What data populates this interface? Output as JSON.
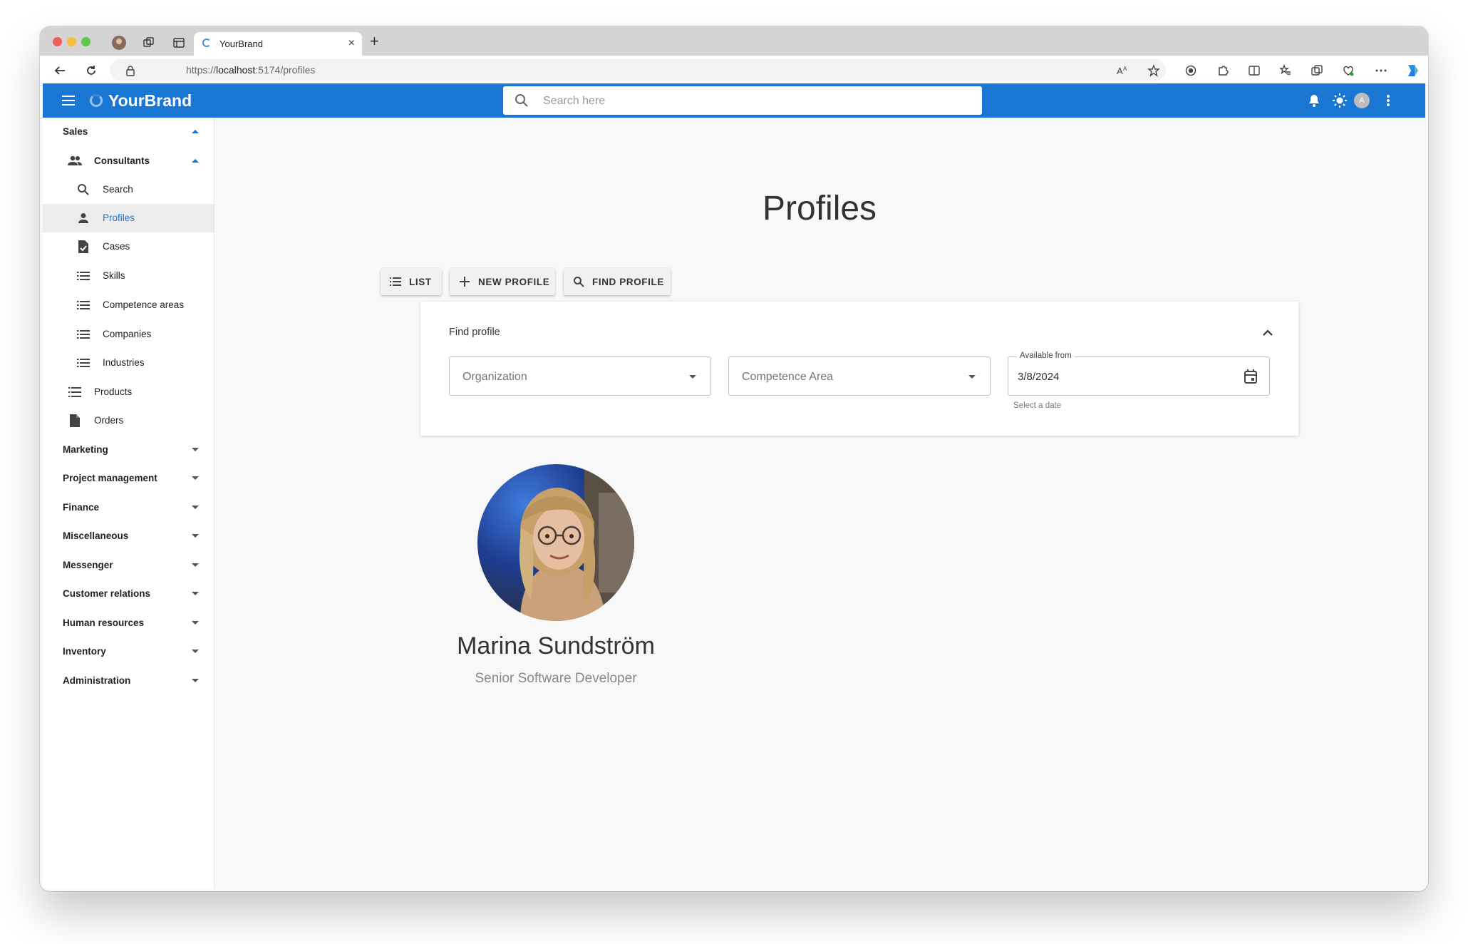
{
  "browser": {
    "tab_title": "YourBrand",
    "url_prefix": "https://",
    "url_host": "localhost",
    "url_path": ":5174/profiles",
    "new_tab_symbol": "+",
    "close_symbol": "×"
  },
  "appbar": {
    "brand": "YourBrand",
    "search_placeholder": "Search here",
    "avatar_initial": "A",
    "color": "#1976d2"
  },
  "sidebar": {
    "groups": [
      {
        "label": "Sales",
        "expanded": true
      },
      {
        "label": "Marketing"
      },
      {
        "label": "Project management"
      },
      {
        "label": "Finance"
      },
      {
        "label": "Miscellaneous"
      },
      {
        "label": "Messenger"
      },
      {
        "label": "Customer relations"
      },
      {
        "label": "Human resources"
      },
      {
        "label": "Inventory"
      },
      {
        "label": "Administration"
      }
    ],
    "sales_items": {
      "consultants": "Consultants",
      "search": "Search",
      "profiles": "Profiles",
      "cases": "Cases",
      "skills": "Skills",
      "competence_areas": "Competence areas",
      "companies": "Companies",
      "industries": "Industries",
      "products": "Products",
      "orders": "Orders"
    },
    "active_item": "Profiles"
  },
  "main": {
    "title": "Profiles",
    "buttons": {
      "list": "LIST",
      "new_profile": "NEW PROFILE",
      "find_profile": "FIND PROFILE"
    },
    "find_panel": {
      "title": "Find profile",
      "organization_placeholder": "Organization",
      "competence_placeholder": "Competence Area",
      "available_from_label": "Available from",
      "available_from_value": "3/8/2024",
      "date_hint": "Select a date"
    },
    "profile": {
      "name": "Marina Sundström",
      "role": "Senior Software Developer"
    }
  }
}
